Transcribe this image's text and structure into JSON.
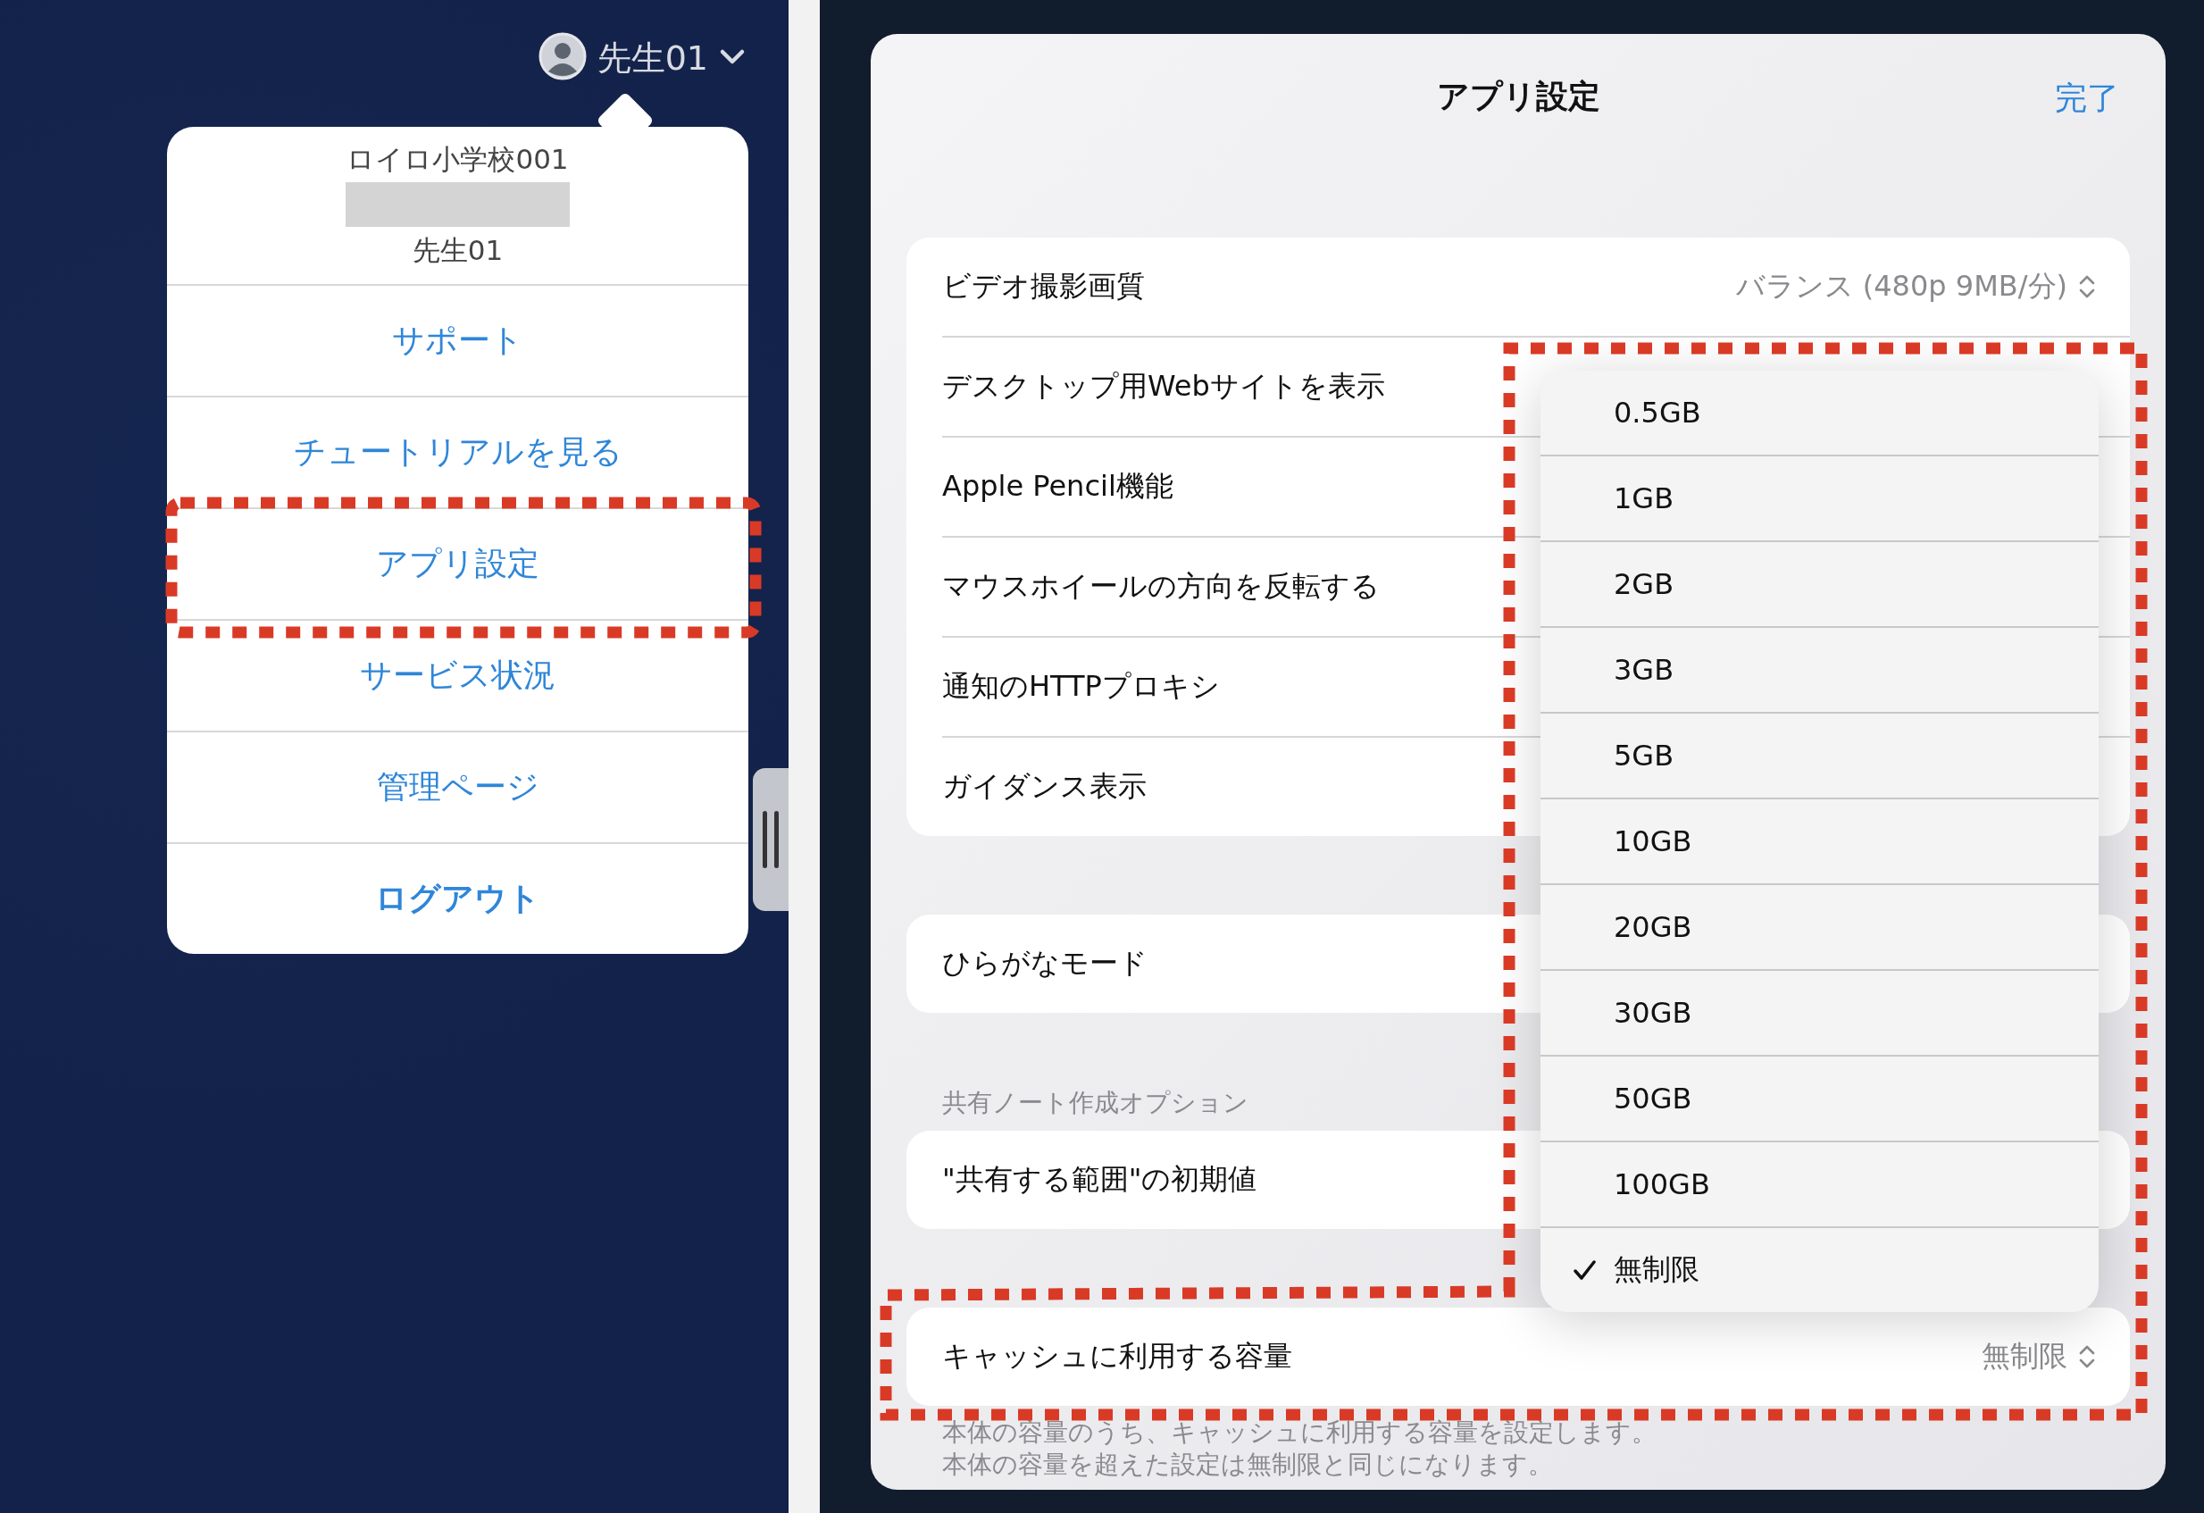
{
  "user_menu": {
    "account_label": "先生01",
    "school": "ロイロ小学校001",
    "user_name": "先生01",
    "items": [
      {
        "label": "サポート",
        "kind": "link"
      },
      {
        "label": "チュートリアルを見る",
        "kind": "link"
      },
      {
        "label": "アプリ設定",
        "kind": "link"
      },
      {
        "label": "サービス状況",
        "kind": "link"
      },
      {
        "label": "管理ページ",
        "kind": "link"
      },
      {
        "label": "ログアウト",
        "kind": "strong"
      }
    ]
  },
  "settings": {
    "title": "アプリ設定",
    "done": "完了",
    "groups": [
      {
        "rows": [
          {
            "label": "ビデオ撮影画質",
            "value": "バランス (480p 9MB/分)"
          },
          {
            "label": "デスクトップ用Webサイトを表示"
          },
          {
            "label": "Apple Pencil機能"
          },
          {
            "label": "マウスホイールの方向を反転する"
          },
          {
            "label": "通知のHTTPプロキシ"
          },
          {
            "label": "ガイダンス表示"
          }
        ]
      },
      {
        "rows": [
          {
            "label": "ひらがなモード"
          }
        ]
      },
      {
        "header": "共有ノート作成オプション",
        "rows": [
          {
            "label": "\"共有する範囲\"の初期値"
          }
        ]
      },
      {
        "rows": [
          {
            "label": "キャッシュに利用する容量",
            "value": "無制限"
          }
        ],
        "footer": [
          "本体の容量のうち、キャッシュに利用する容量を設定します。",
          "本体の容量を超えた設定は無制限と同じになります。"
        ]
      }
    ]
  },
  "size_menu": {
    "options": [
      {
        "label": "0.5GB",
        "selected": false
      },
      {
        "label": "1GB",
        "selected": false
      },
      {
        "label": "2GB",
        "selected": false
      },
      {
        "label": "3GB",
        "selected": false
      },
      {
        "label": "5GB",
        "selected": false
      },
      {
        "label": "10GB",
        "selected": false
      },
      {
        "label": "20GB",
        "selected": false
      },
      {
        "label": "30GB",
        "selected": false
      },
      {
        "label": "50GB",
        "selected": false
      },
      {
        "label": "100GB",
        "selected": false
      },
      {
        "label": "無制限",
        "selected": true
      }
    ]
  }
}
